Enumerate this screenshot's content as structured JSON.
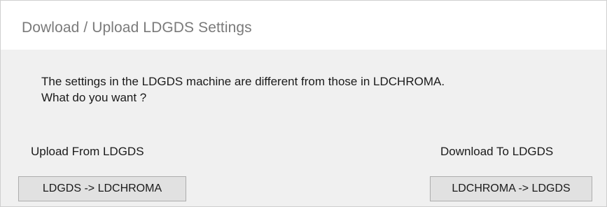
{
  "window": {
    "title": "Dowload / Upload LDGDS Settings"
  },
  "message": {
    "line1": "The settings in the LDGDS machine are different from those in LDCHROMA.",
    "line2": "What do you want ?"
  },
  "upload": {
    "label": "Upload From LDGDS",
    "button_label": "LDGDS -> LDCHROMA"
  },
  "download": {
    "label": "Download To LDGDS",
    "button_label": "LDCHROMA -> LDGDS"
  }
}
